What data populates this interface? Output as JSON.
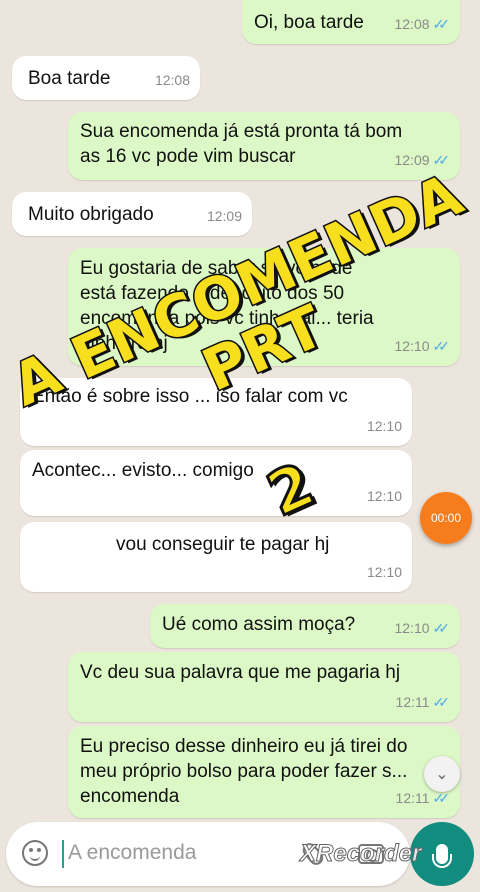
{
  "messages": [
    {
      "dir": "out",
      "text": "Oi, boa tarde",
      "time": "12:08",
      "read": true
    },
    {
      "dir": "in",
      "text": "Boa tarde",
      "time": "12:08"
    },
    {
      "dir": "out",
      "text": "Sua encomenda já está pronta tá bom as 16 vc pode vim buscar",
      "time": "12:09",
      "read": true
    },
    {
      "dir": "in",
      "text": "Muito obrigado",
      "time": "12:09"
    },
    {
      "dir": "out",
      "text": "Eu gostaria de saber se vc pode está fazendo o depósito dos 50 encomenda pois vc tinha fal... teria dinheiro hj",
      "time": "12:10",
      "read": true
    },
    {
      "dir": "in",
      "text": "Então é sobre isso ... iso falar com vc",
      "time": "12:10"
    },
    {
      "dir": "in",
      "text": "Acontec... evisto... comigo",
      "time": "12:10"
    },
    {
      "dir": "in",
      "text": "vou conseguir te pagar hj",
      "time": "12:10"
    },
    {
      "dir": "out",
      "text": "Ué como assim moça?",
      "time": "12:10",
      "read": true
    },
    {
      "dir": "out",
      "text": "Vc deu sua palavra que me pagaria hj",
      "time": "12:11",
      "read": true
    },
    {
      "dir": "out",
      "text": "Eu preciso desse dinheiro eu já tirei do meu próprio bolso para poder fazer s... encomenda",
      "time": "12:11",
      "read": true
    }
  ],
  "overlay": {
    "title": "A ENCOMENDA PRT",
    "number": "2"
  },
  "timer": "00:00",
  "composer": {
    "placeholder": "A encomenda"
  },
  "watermark": "XRecorder",
  "colors": {
    "outgoing": "#dcf8c6",
    "incoming": "#ffffff",
    "background": "#ece5dd",
    "ticks": "#4fa9e8",
    "mic": "#128c7e",
    "overlay": "#f7df1e"
  }
}
